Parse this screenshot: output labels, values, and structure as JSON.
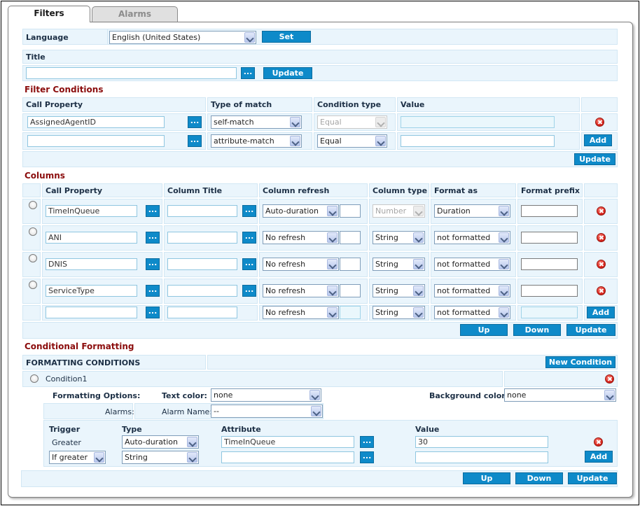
{
  "tabs": {
    "filters": "Filters",
    "alarms": "Alarms"
  },
  "language": {
    "label": "Language",
    "value": "English (United States)",
    "set_label": "Set"
  },
  "title_section": {
    "label": "Title",
    "value": "",
    "update_label": "Update",
    "browse_label": "..."
  },
  "filter_conditions": {
    "heading": "Filter Conditions",
    "headers": [
      "Call Property",
      "Type of match",
      "Condition type",
      "Value"
    ],
    "rows": [
      {
        "call_property": "AssignedAgentID",
        "type_of_match": "self-match",
        "condition_type": "Equal",
        "value": ""
      },
      {
        "call_property": "",
        "type_of_match": "attribute-match",
        "condition_type": "Equal",
        "value": ""
      }
    ],
    "add_label": "Add",
    "update_label": "Update"
  },
  "columns": {
    "heading": "Columns",
    "headers": [
      "Call Property",
      "Column Title",
      "Column refresh",
      "Column type",
      "Format as",
      "Format prefix"
    ],
    "rows": [
      {
        "call_property": "TimeInQueue",
        "column_title": "",
        "refresh": "Auto-duration",
        "type": "Number",
        "format": "Duration",
        "prefix": ""
      },
      {
        "call_property": "ANI",
        "column_title": "",
        "refresh": "No refresh",
        "type": "String",
        "format": "not formatted",
        "prefix": ""
      },
      {
        "call_property": "DNIS",
        "column_title": "",
        "refresh": "No refresh",
        "type": "String",
        "format": "not formatted",
        "prefix": ""
      },
      {
        "call_property": "ServiceType",
        "column_title": "",
        "refresh": "No refresh",
        "type": "String",
        "format": "not formatted",
        "prefix": ""
      },
      {
        "call_property": "",
        "column_title": "",
        "refresh": "No refresh",
        "type": "String",
        "format": "not formatted",
        "prefix": ""
      }
    ],
    "add_label": "Add",
    "up_label": "Up",
    "down_label": "Down",
    "update_label": "Update"
  },
  "conditional_formatting": {
    "heading": "Conditional Formatting",
    "sub_heading": "FORMATTING CONDITIONS",
    "new_condition_label": "New Condition",
    "condition_name": "Condition1",
    "formatting_options_label": "Formatting Options:",
    "text_color_label": "Text color:",
    "text_color_value": "none",
    "background_color_label": "Background color:",
    "background_color_value": "none",
    "alarms_label": "Alarms:",
    "alarm_name_label": "Alarm Name:",
    "alarm_name_value": "--",
    "trigger_headers": [
      "Trigger",
      "Type",
      "Attribute",
      "Value"
    ],
    "trigger_rows": [
      {
        "trigger": "Greater",
        "type": "Auto-duration",
        "attribute": "TimeInQueue",
        "value": "30"
      },
      {
        "trigger": "If greater",
        "type": "String",
        "attribute": "",
        "value": ""
      }
    ],
    "add_label": "Add",
    "up_label": "Up",
    "down_label": "Down",
    "update_label": "Update"
  },
  "colors": {
    "accent": "#0e8ac9",
    "section": "#8b0d0d",
    "row_bg": "#eaf5fc",
    "label": "#1c2f45"
  },
  "icons": {
    "delete": "delete-icon",
    "dropdown": "chevron-down-icon",
    "browse": "ellipsis-icon"
  }
}
